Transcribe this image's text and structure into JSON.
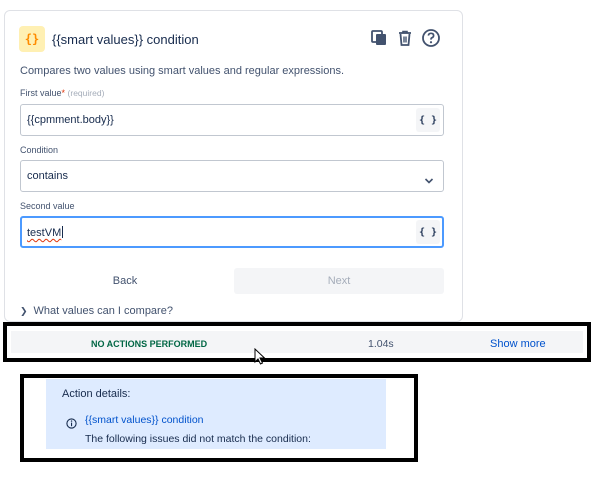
{
  "component": {
    "icon_glyph": "{}",
    "title": "{{smart values}} condition",
    "description": "Compares two values using smart values and regular expressions.",
    "toolbar": {
      "copy_icon": "copy-icon",
      "delete_icon": "trash-icon",
      "help_icon": "help-icon"
    }
  },
  "form": {
    "first_value": {
      "label": "First value",
      "required_marker": "*",
      "hint": "(required)",
      "value": "{{cpmment.body}}"
    },
    "condition": {
      "label": "Condition",
      "selected": "contains"
    },
    "second_value": {
      "label": "Second value",
      "value": "testVM"
    },
    "smart_value_button": "{ }",
    "back_label": "Back",
    "next_label": "Next",
    "expander_label": "What values can I compare?"
  },
  "audit": {
    "status": "NO ACTIONS PERFORMED",
    "duration": "1.04s",
    "show_more": "Show more"
  },
  "action_details": {
    "title": "Action details:",
    "item_title": "{{smart values}} condition",
    "item_message": "The following issues did not match the condition:"
  },
  "colors": {
    "link": "#0052cc",
    "success_text": "#006644",
    "focus_border": "#4c9aff",
    "details_bg": "#deebff",
    "icon_bg": "#fff0b3",
    "icon_fg": "#ff8b00"
  }
}
